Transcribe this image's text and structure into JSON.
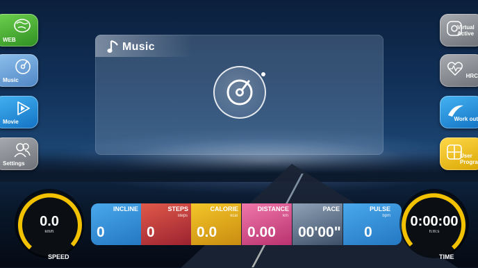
{
  "left_buttons": [
    {
      "label": "WEB",
      "icon": "globe-icon",
      "color": "#4caf36"
    },
    {
      "label": "Music",
      "icon": "music-disc-icon",
      "color": "#6aa4de"
    },
    {
      "label": "Movie",
      "icon": "play-icon",
      "color": "#1a8fd6"
    },
    {
      "label": "Settings",
      "icon": "users-icon",
      "color": "#8c8f95"
    }
  ],
  "right_buttons": [
    {
      "label": "Virtual Active",
      "icon": "location-icon",
      "color": "#8c8f95"
    },
    {
      "label": "HRC",
      "icon": "heart-rate-icon",
      "color": "#8c8f95"
    },
    {
      "label": "Work out",
      "icon": "swoosh-icon",
      "color": "#1a8fd6"
    },
    {
      "label": "User Program",
      "icon": "grid-icon",
      "color": "#f2c200"
    }
  ],
  "music_panel": {
    "title": "Music",
    "icon": "music-note-icon"
  },
  "stats": [
    {
      "head": "INCLINE",
      "sub": "",
      "value": "0",
      "color": "#2c8fd8"
    },
    {
      "head": "STEPS",
      "sub": "steps",
      "value": "0",
      "color": "#c9303b"
    },
    {
      "head": "CALORIE",
      "sub": "kcal",
      "value": "0.0",
      "color": "#e6b414"
    },
    {
      "head": "DISTANCE",
      "sub": "km",
      "value": "0.00",
      "color": "#d6508a"
    },
    {
      "head": "PACE",
      "sub": "",
      "value": "00'00\"",
      "color": "#5c6f86"
    },
    {
      "head": "PULSE",
      "sub": "bpm",
      "value": "0",
      "color": "#2c8fd8"
    }
  ],
  "speed": {
    "value": "0.0",
    "unit": "km/h",
    "label": "SPEED"
  },
  "time": {
    "value": "0:00:00",
    "unit": "h:m:s",
    "label": "TIME"
  },
  "accent_color": "#f2c200"
}
